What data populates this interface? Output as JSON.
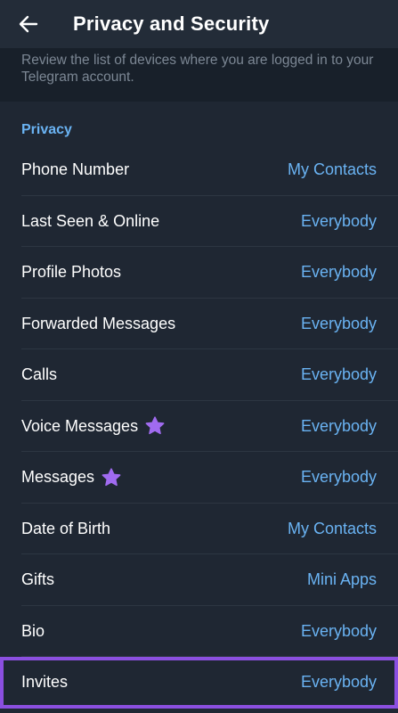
{
  "header": {
    "title": "Privacy and Security",
    "back_icon": "arrow-left-icon"
  },
  "info": {
    "text": "Review the list of devices where you are logged in to your Telegram account."
  },
  "privacy": {
    "section_title": "Privacy",
    "items": [
      {
        "label": "Phone Number",
        "value": "My Contacts",
        "premium": false
      },
      {
        "label": "Last Seen & Online",
        "value": "Everybody",
        "premium": false
      },
      {
        "label": "Profile Photos",
        "value": "Everybody",
        "premium": false
      },
      {
        "label": "Forwarded Messages",
        "value": "Everybody",
        "premium": false
      },
      {
        "label": "Calls",
        "value": "Everybody",
        "premium": false
      },
      {
        "label": "Voice Messages",
        "value": "Everybody",
        "premium": true
      },
      {
        "label": "Messages",
        "value": "Everybody",
        "premium": true
      },
      {
        "label": "Date of Birth",
        "value": "My Contacts",
        "premium": false
      },
      {
        "label": "Gifts",
        "value": "Mini Apps",
        "premium": false
      },
      {
        "label": "Bio",
        "value": "Everybody",
        "premium": false
      },
      {
        "label": "Invites",
        "value": "Everybody",
        "premium": false,
        "highlighted": true
      }
    ]
  },
  "colors": {
    "accent": "#6ab3f3",
    "premium_star": "#a06bf0",
    "highlight_border": "#8b4fe0",
    "background": "#1f2733"
  }
}
